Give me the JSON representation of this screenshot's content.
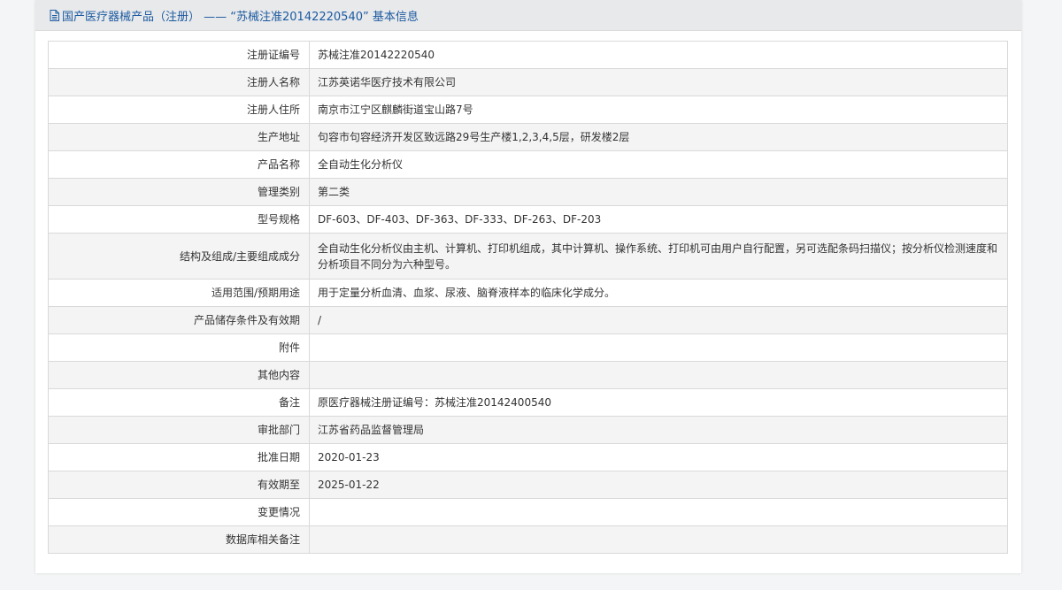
{
  "header": {
    "title": "国产医疗器械产品（注册） —— “苏械注准20142220540” 基本信息"
  },
  "rows": [
    {
      "label": "注册证编号",
      "value": "苏械注准20142220540"
    },
    {
      "label": "注册人名称",
      "value": "江苏英诺华医疗技术有限公司"
    },
    {
      "label": "注册人住所",
      "value": "南京市江宁区麒麟街道宝山路7号"
    },
    {
      "label": "生产地址",
      "value": "句容市句容经济开发区致远路29号生产楼1,2,3,4,5层，研发楼2层"
    },
    {
      "label": "产品名称",
      "value": "全自动生化分析仪"
    },
    {
      "label": "管理类别",
      "value": "第二类"
    },
    {
      "label": "型号规格",
      "value": "DF-603、DF-403、DF-363、DF-333、DF-263、DF-203"
    },
    {
      "label": "结构及组成/主要组成成分",
      "value": "全自动生化分析仪由主机、计算机、打印机组成，其中计算机、操作系统、打印机可由用户自行配置，另可选配条码扫描仪；按分析仪检测速度和分析项目不同分为六种型号。"
    },
    {
      "label": "适用范围/预期用途",
      "value": "用于定量分析血清、血浆、尿液、脑脊液样本的临床化学成分。"
    },
    {
      "label": "产品储存条件及有效期",
      "value": "/"
    },
    {
      "label": "附件",
      "value": ""
    },
    {
      "label": "其他内容",
      "value": ""
    },
    {
      "label": "备注",
      "value": "原医疗器械注册证编号：苏械注准20142400540"
    },
    {
      "label": "审批部门",
      "value": "江苏省药品监督管理局"
    },
    {
      "label": "批准日期",
      "value": "2020-01-23"
    },
    {
      "label": "有效期至",
      "value": "2025-01-22"
    },
    {
      "label": "变更情况",
      "value": ""
    },
    {
      "label": "数据库相关备注",
      "value": ""
    }
  ]
}
